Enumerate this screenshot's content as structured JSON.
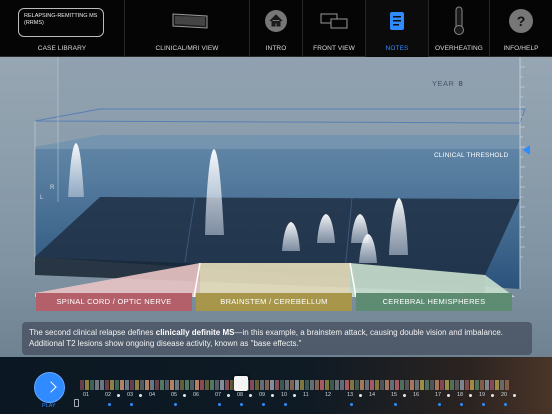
{
  "topbar": {
    "case_box_text": "RELAPSING-REMITTING MS (RRMS)",
    "items": [
      {
        "label": "CASE LIBRARY"
      },
      {
        "label": "CLINICAL/MRI VIEW"
      },
      {
        "label": "INTRO"
      },
      {
        "label": "FRONT VIEW"
      },
      {
        "label": "NOTES"
      },
      {
        "label": "OVERHEATING"
      },
      {
        "label": "INFO/HELP"
      }
    ],
    "active_item": "NOTES",
    "accent_color": "#2f8bff",
    "intro_tab_glyph": "⌄"
  },
  "scene": {
    "year_label": "YEAR",
    "year_value": "8",
    "threshold_label": "CLINICAL THRESHOLD",
    "side_letters": [
      "R",
      "L"
    ],
    "regions": [
      {
        "label": "SPINAL CORD / OPTIC NERVE",
        "color": "#b4606a"
      },
      {
        "label": "BRAINSTEM / CEREBELLUM",
        "color": "#a8974a"
      },
      {
        "label": "CEREBRAL HEMISPHERES",
        "color": "#5e8c72"
      }
    ]
  },
  "note": {
    "text_before": "The second clinical relapse defines ",
    "text_bold": "clinically definite MS",
    "text_after": "—in this example, a brainstem attack, causing double vision and imbalance. Additional T2 lesions show ongoing disease activity, known as \"base effects.\""
  },
  "timeline": {
    "play_label": "PLAY",
    "years": [
      "01",
      "02",
      "03",
      "04",
      "05",
      "06",
      "07",
      "08",
      "09",
      "10",
      "11",
      "12",
      "13",
      "14",
      "15",
      "16",
      "17",
      "18",
      "19",
      "20"
    ],
    "current_year": "08"
  }
}
